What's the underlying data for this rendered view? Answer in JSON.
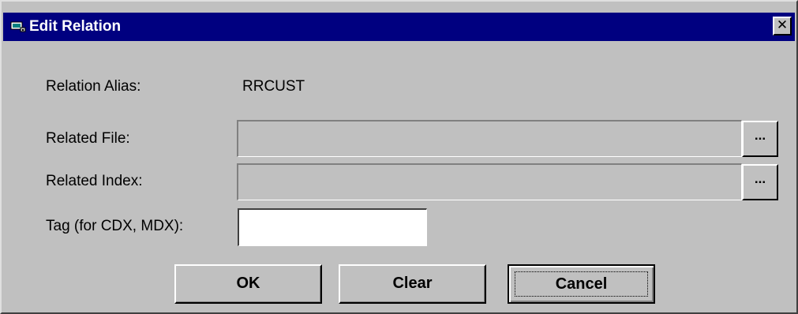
{
  "window": {
    "title": "Edit Relation",
    "close_label": "✕"
  },
  "form": {
    "relation_alias_label": "Relation Alias:",
    "relation_alias_value": "RRCUST",
    "related_file_label": "Related File:",
    "related_file_value": "",
    "related_index_label": "Related Index:",
    "related_index_value": "",
    "tag_label": "Tag (for CDX, MDX):",
    "tag_value": "",
    "browse_label": "..."
  },
  "buttons": {
    "ok": "OK",
    "clear": "Clear",
    "cancel": "Cancel"
  },
  "colors": {
    "titlebar": "#000080",
    "face": "#c0c0c0"
  }
}
